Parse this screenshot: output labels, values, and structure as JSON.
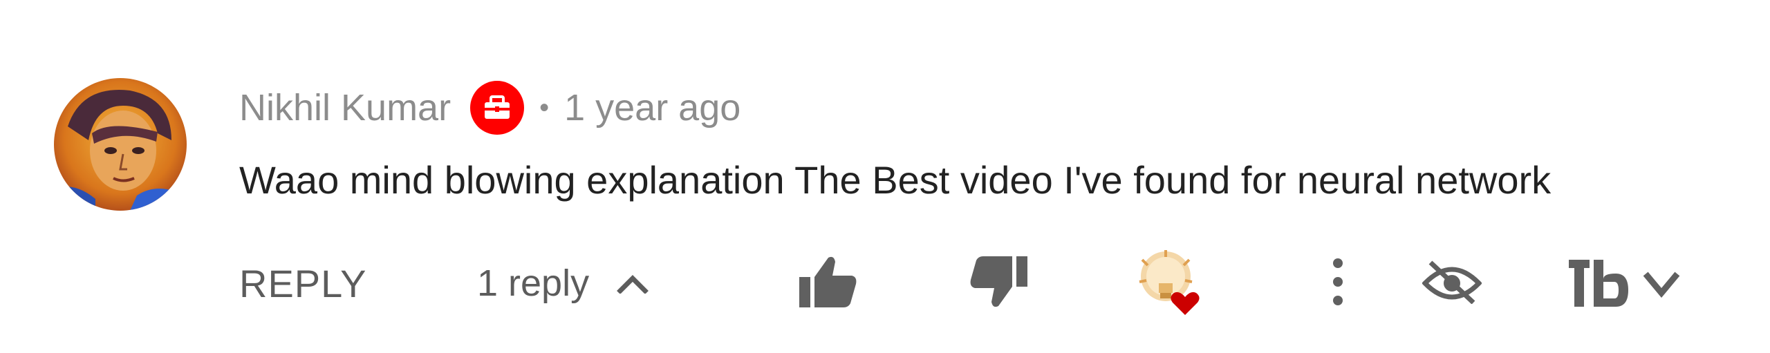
{
  "comment": {
    "author": "Nikhil Kumar",
    "separator": "•",
    "time": "1 year ago",
    "text": "Waao mind blowing explanation The Best video I've found for neural network"
  },
  "actions": {
    "reply_label": "REPLY",
    "replies_label": "1 reply"
  },
  "icons": {
    "sponsor_badge": "sponsor-badge-icon",
    "replies_toggle": "chevron-up-icon",
    "like": "thumbs-up-icon",
    "dislike": "thumbs-down-icon",
    "creator_heart": "creator-heart-icon",
    "more": "more-vert-icon",
    "hide": "eye-off-icon",
    "extension": "tb-extension-icon"
  },
  "colors": {
    "badge": "#ff0000",
    "heart": "#cc0000",
    "muted_text": "#8c8c8c",
    "body_text": "#222222",
    "icon": "#606060"
  }
}
